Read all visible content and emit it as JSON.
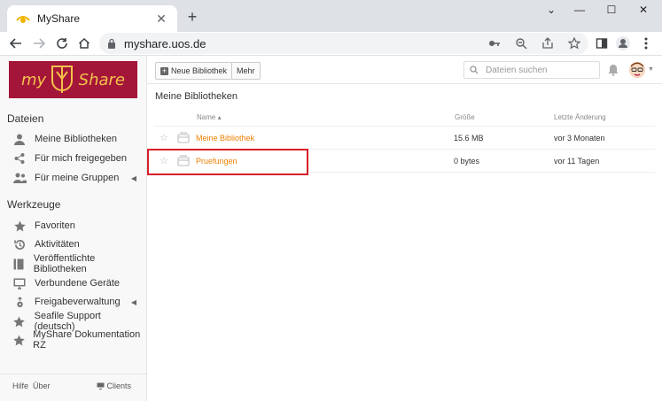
{
  "browser": {
    "tab_title": "MyShare",
    "tab_close": "✕",
    "new_tab": "+",
    "url": "myshare.uos.de",
    "window_controls": [
      "⌄",
      "—",
      "☐",
      "✕"
    ]
  },
  "logo": {
    "left_text": "my",
    "right_text": "Share"
  },
  "sidebar": {
    "files_title": "Dateien",
    "files_items": [
      {
        "label": "Meine Bibliotheken",
        "icon": "user-icon"
      },
      {
        "label": "Für mich freigegeben",
        "icon": "share-icon"
      },
      {
        "label": "Für meine Gruppen",
        "icon": "group-icon",
        "has_caret": true
      }
    ],
    "tools_title": "Werkzeuge",
    "tools_items": [
      {
        "label": "Favoriten",
        "icon": "star-icon"
      },
      {
        "label": "Aktivitäten",
        "icon": "history-icon"
      },
      {
        "label": "Veröffentlichte Bibliotheken",
        "icon": "book-icon"
      },
      {
        "label": "Verbundene Geräte",
        "icon": "monitor-icon"
      },
      {
        "label": "Freigabeverwaltung",
        "icon": "share-manage-icon",
        "has_caret": true
      },
      {
        "label": "Seafile Support (deutsch)",
        "icon": "star-icon"
      },
      {
        "label": "MyShare Dokumentation RZ",
        "icon": "star-icon"
      }
    ],
    "caret": "◀",
    "footer": {
      "help": "Hilfe",
      "about": "Über",
      "clients": "Clients"
    }
  },
  "toolbar": {
    "new_library_label": "Neue Bibliothek",
    "more_label": "Mehr",
    "search_placeholder": "Dateien suchen"
  },
  "main": {
    "heading": "Meine Bibliotheken",
    "columns": {
      "name": "Name ▴",
      "size": "Größe",
      "modified": "Letzte Änderung"
    },
    "rows": [
      {
        "name": "Meine Bibliothek",
        "size": "15.6 MB",
        "modified": "vor 3 Monaten"
      },
      {
        "name": "Pruefungen",
        "size": "0 bytes",
        "modified": "vor 11 Tagen"
      }
    ]
  },
  "colors": {
    "accent": "#ec8000",
    "logo_bg": "#a4153a",
    "highlight": "#d81e2b"
  }
}
